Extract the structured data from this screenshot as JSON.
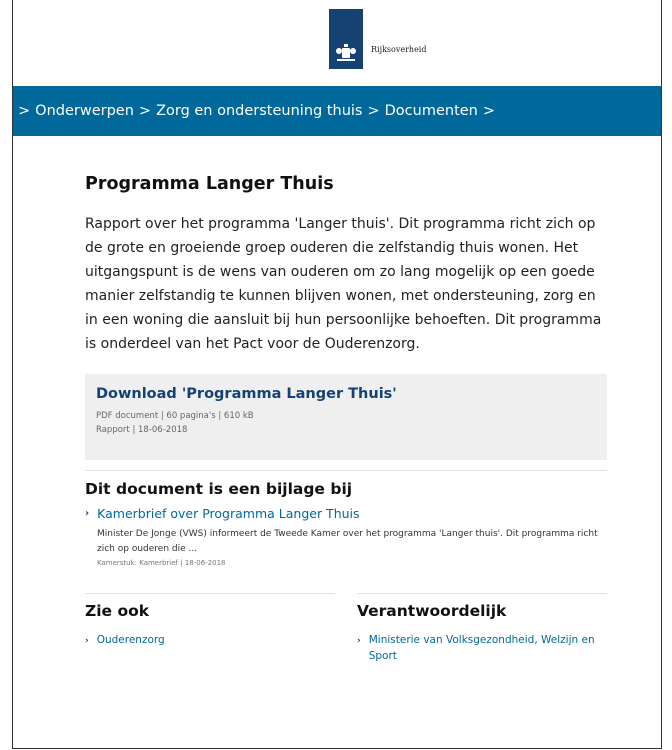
{
  "header": {
    "logo_text": "Rijksoverheid"
  },
  "breadcrumb": {
    "items": [
      "Onderwerpen",
      "Zorg en ondersteuning thuis",
      "Documenten"
    ],
    "separator": ">"
  },
  "main": {
    "title": "Programma Langer Thuis",
    "intro": "Rapport over het programma 'Langer thuis'. Dit programma richt zich op de grote en groeiende groep ouderen die zelfstandig thuis wonen. Het uitgangspunt is de wens van ouderen om zo lang mogelijk op een goede manier zelfstandig te kunnen blijven wonen, met ondersteuning, zorg en in een woning die aansluit bij hun persoonlijke behoeften. Dit programma is onderdeel van het Pact voor de Ouderenzorg.",
    "download": {
      "label": "Download 'Programma Langer Thuis'",
      "file_info": "PDF document | 60 pagina's | 610 kB",
      "doc_info": "Rapport | 18-06-2018"
    }
  },
  "attachment": {
    "title": "Dit document is een bijlage bij",
    "link_label": "Kamerbrief over Programma Langer Thuis",
    "summary": "Minister De Jonge (VWS) informeert de Tweede Kamer over het programma 'Langer thuis'. Dit programma richt zich op ouderen die ...",
    "meta": "Kamerstuk: Kamerbrief | 18-06-2018"
  },
  "see_also": {
    "title": "Zie ook",
    "link_label": "Ouderenzorg"
  },
  "responsible": {
    "title": "Verantwoordelijk",
    "link_label": "Ministerie van Volksgezondheid, Welzijn en Sport"
  },
  "icons": {
    "chevron": "chevron-right-icon",
    "emblem": "coat-of-arms-icon"
  },
  "colors": {
    "brand_blue": "#01689b",
    "emblem_blue": "#154273",
    "download_bg": "#efefef"
  }
}
